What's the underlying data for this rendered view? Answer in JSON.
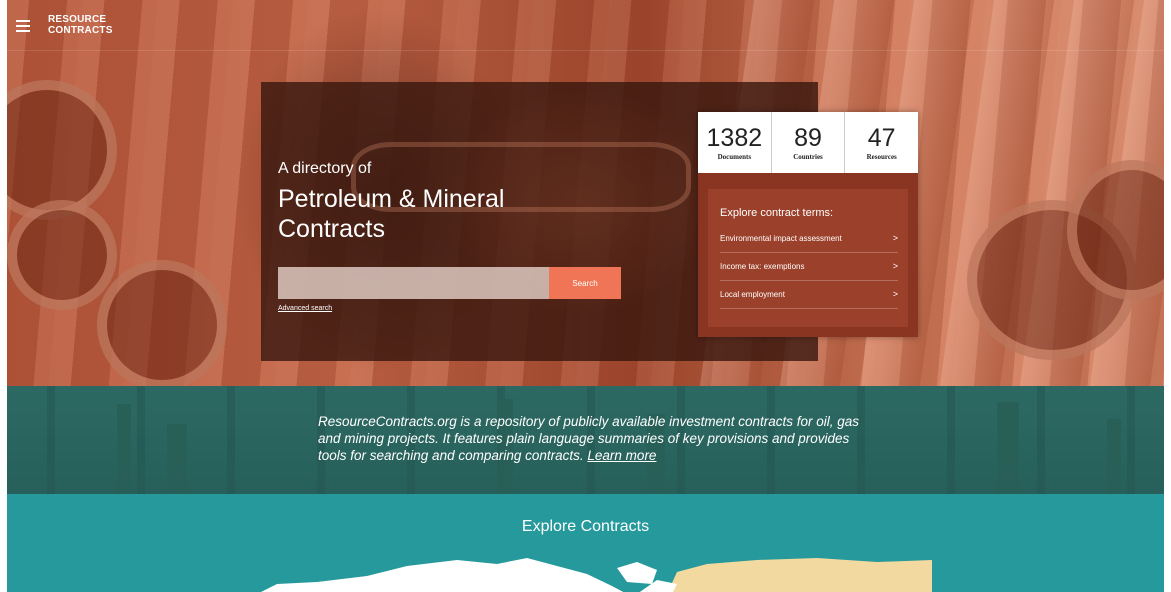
{
  "header": {
    "logo_line1": "RESOURCE",
    "logo_line2": "CONTRACTS"
  },
  "hero": {
    "tagline_small": "A directory of",
    "tagline_big": "Petroleum & Mineral Contracts",
    "search": {
      "value": "",
      "button_label": "Search"
    },
    "advanced_search_label": "Advanced search"
  },
  "stats": [
    {
      "number": "1382",
      "label": "Documents"
    },
    {
      "number": "89",
      "label": "Countries"
    },
    {
      "number": "47",
      "label": "Resources"
    }
  ],
  "explore_terms": {
    "heading": "Explore contract terms:",
    "items": [
      {
        "label": "Environmental impact assessment"
      },
      {
        "label": "Income tax: exemptions"
      },
      {
        "label": "Local employment"
      }
    ],
    "chevron": ">"
  },
  "info": {
    "text": "ResourceContracts.org is a repository of publicly available investment contracts for oil, gas and mining projects. It features plain language summaries of key provisions and provides tools for searching and comparing contracts.",
    "learn_more": "Learn more"
  },
  "explore": {
    "title": "Explore Contracts"
  },
  "colors": {
    "accent": "#f07556",
    "teal_band": "#2b6560",
    "explore_bg": "#25999b",
    "terms_bg": "#9b402a"
  },
  "icons": [
    "menu-icon",
    "chevron-right-icon"
  ]
}
